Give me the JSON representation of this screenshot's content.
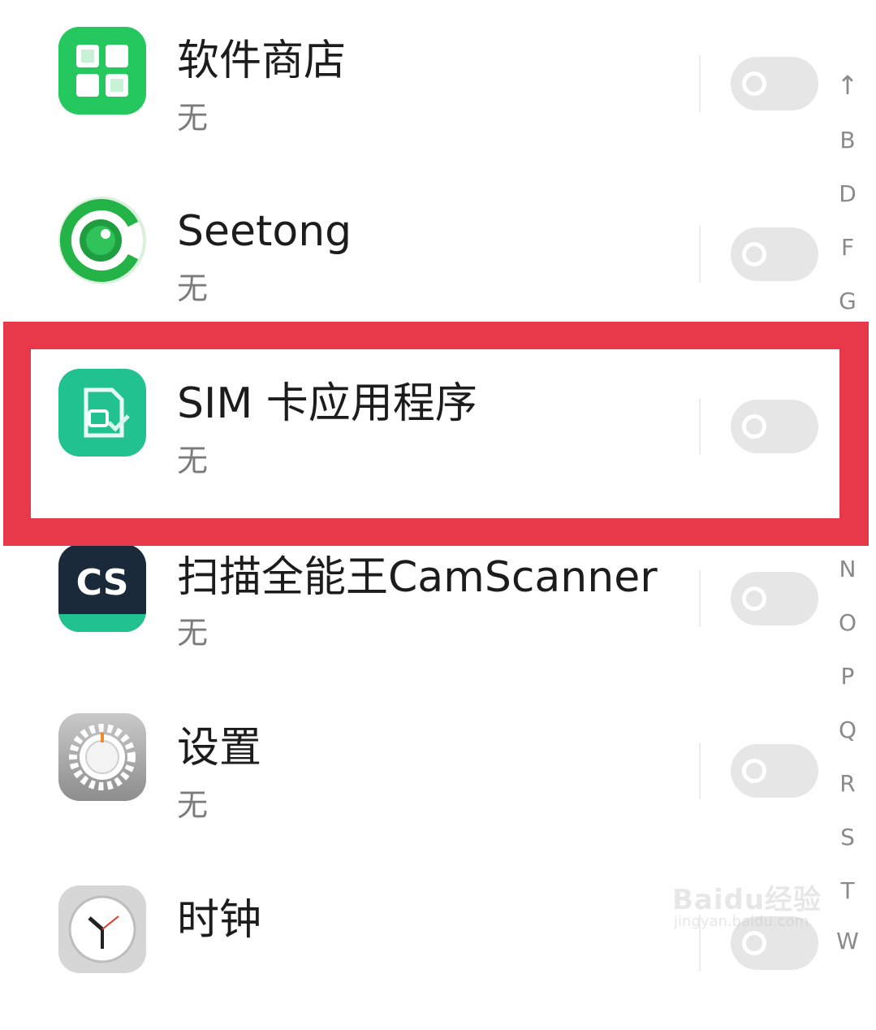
{
  "apps": [
    {
      "name": "软件商店",
      "subtitle": "无",
      "icon": "store-icon"
    },
    {
      "name": "Seetong",
      "subtitle": "无",
      "icon": "camera-lens-icon"
    },
    {
      "name": "SIM 卡应用程序",
      "subtitle": "无",
      "icon": "sim-card-icon"
    },
    {
      "name": "扫描全能王CamScanner",
      "subtitle": "无",
      "icon": "camscanner-icon",
      "icon_text": "CS"
    },
    {
      "name": "设置",
      "subtitle": "无",
      "icon": "gear-icon"
    },
    {
      "name": "时钟",
      "subtitle": "无",
      "icon": "clock-icon"
    }
  ],
  "toggles_enabled": false,
  "index_bar": [
    "↑",
    "B",
    "D",
    "F",
    "G",
    "N",
    "O",
    "P",
    "Q",
    "R",
    "S",
    "T",
    "W"
  ],
  "highlight_color": "#e8394b",
  "watermark": {
    "main": "Baidu经验",
    "sub": "jingyan.baidu.com"
  }
}
